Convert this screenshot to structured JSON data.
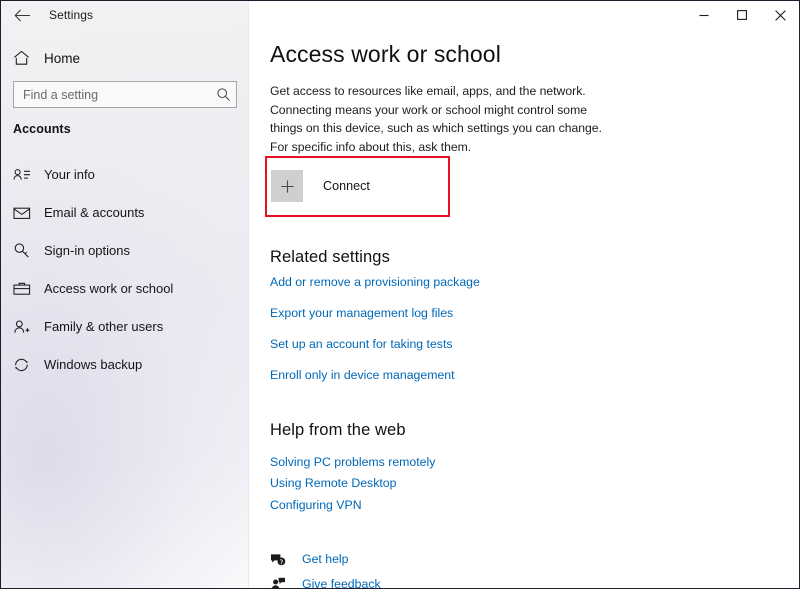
{
  "window": {
    "title": "Settings",
    "back_icon": "back-arrow-icon",
    "controls": [
      {
        "name": "minimize-button",
        "glyph": "minimize-icon"
      },
      {
        "name": "maximize-button",
        "glyph": "maximize-icon"
      },
      {
        "name": "close-button",
        "glyph": "close-icon"
      }
    ]
  },
  "sidebar": {
    "home": {
      "label": "Home",
      "icon": "home-icon"
    },
    "search": {
      "placeholder": "Find a setting",
      "value": "",
      "icon": "search-icon"
    },
    "group_title": "Accounts",
    "items": [
      {
        "label": "Your info",
        "icon": "user-info-icon"
      },
      {
        "label": "Email & accounts",
        "icon": "envelope-icon"
      },
      {
        "label": "Sign-in options",
        "icon": "key-icon"
      },
      {
        "label": "Access work or school",
        "icon": "briefcase-icon"
      },
      {
        "label": "Family & other users",
        "icon": "user-plus-icon"
      },
      {
        "label": "Windows backup",
        "icon": "sync-icon"
      }
    ]
  },
  "main": {
    "title": "Access work or school",
    "description": "Get access to resources like email, apps, and the network. Connecting means your work or school might control some things on this device, such as which settings you can change. For specific info about this, ask them.",
    "connect": {
      "label": "Connect",
      "icon": "plus-icon",
      "highlight_color": "#e81123"
    },
    "related_settings": {
      "title": "Related settings",
      "links": [
        "Add or remove a provisioning package",
        "Export your management log files",
        "Set up an account for taking tests",
        "Enroll only in device management"
      ]
    },
    "help_from_web": {
      "title": "Help from the web",
      "links": [
        "Solving PC problems remotely",
        "Using Remote Desktop",
        "Configuring VPN"
      ]
    },
    "footer_links": [
      {
        "label": "Get help",
        "icon": "help-bubble-icon"
      },
      {
        "label": "Give feedback",
        "icon": "feedback-person-icon"
      }
    ]
  },
  "colors": {
    "accent_link": "#0068b8",
    "highlight_red": "#e81123",
    "sidebar_bg": "#eeeef2"
  }
}
